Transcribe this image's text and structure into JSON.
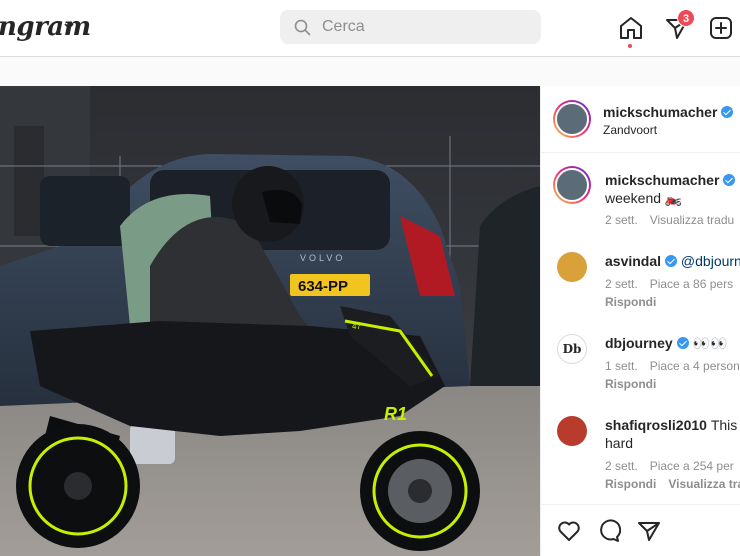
{
  "header": {
    "logo": "ngram",
    "search_placeholder": "Cerca",
    "notifications_count": "3"
  },
  "post": {
    "owner": "mickschumacher",
    "location": "Zandvoort",
    "caption_text": "weekend 🏍️",
    "caption_time": "2 sett.",
    "caption_translate": "Visualizza tradu"
  },
  "comments": [
    {
      "user": "asvindal",
      "text": "@dbjourne",
      "time": "2 sett.",
      "likes": "Piace a 86 pers",
      "reply": "Rispondi"
    },
    {
      "user": "dbjourney",
      "text": "👀👀",
      "time": "1 sett.",
      "likes": "Piace a 4 person",
      "reply": "Rispondi"
    },
    {
      "user": "shafiqrosli2010",
      "text": "This",
      "text2": "hard",
      "time": "2 sett.",
      "likes": "Piace a 254 per",
      "reply": "Rispondi",
      "translate": "Visualizza trad"
    }
  ],
  "photo": {
    "plate": "634-PP",
    "bike_badge": "R1",
    "bike_number": "47",
    "brand_text": "VOLVO"
  },
  "colors": {
    "accent_blue": "#3897f0",
    "notification_red": "#ed4956",
    "bike_neon": "#c6f000"
  },
  "icons": [
    "search-icon",
    "home-icon",
    "direct-icon",
    "new-post-icon",
    "heart-icon",
    "comment-icon",
    "share-icon"
  ]
}
